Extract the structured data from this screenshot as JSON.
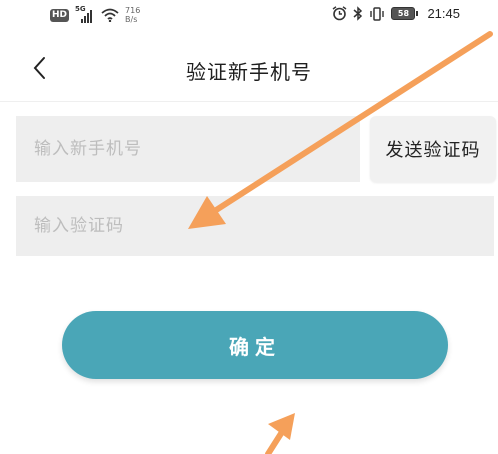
{
  "status_bar": {
    "hd_badge": "HD",
    "network": "5G",
    "speed_value": "716",
    "speed_unit": "B/s",
    "battery": "58",
    "time": "21:45"
  },
  "nav": {
    "title": "验证新手机号",
    "back_icon": "chevron-left-icon"
  },
  "form": {
    "phone_placeholder": "输入新手机号",
    "phone_value": "",
    "code_placeholder": "输入验证码",
    "code_value": "",
    "send_code_label": "发送验证码"
  },
  "actions": {
    "confirm_label": "确定"
  },
  "colors": {
    "accent": "#4aa6b7",
    "field_bg": "#eeeeee",
    "annotation_arrow": "#f5a05a"
  }
}
